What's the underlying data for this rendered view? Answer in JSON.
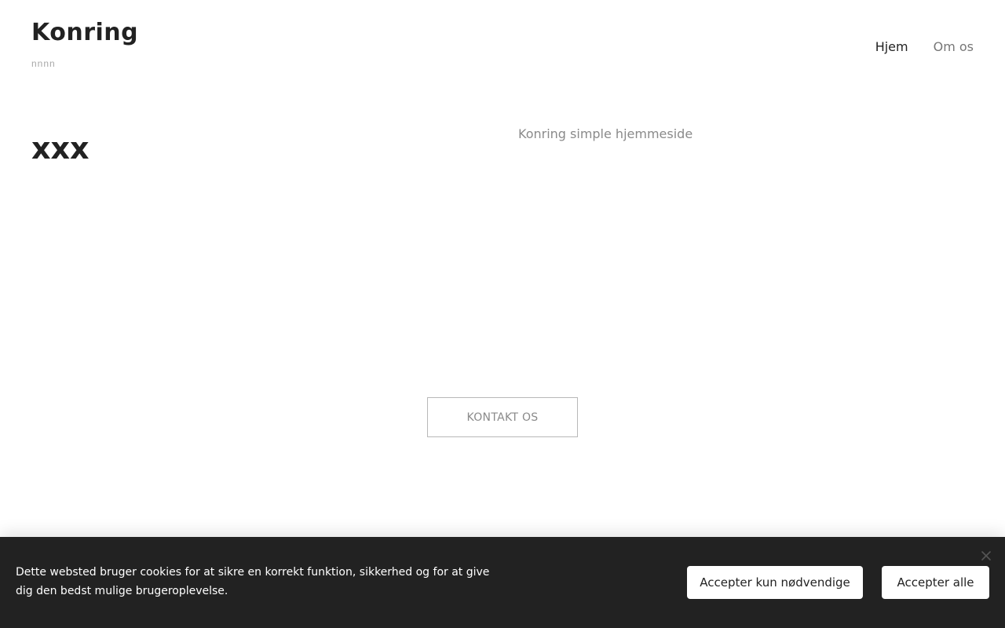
{
  "header": {
    "brand_title": "Konring",
    "brand_tagline": "nnnn",
    "nav": [
      {
        "label": "Hjem",
        "active": true
      },
      {
        "label": "Om os",
        "active": false
      }
    ]
  },
  "hero": {
    "heading": "xxx",
    "subtitle": "Konring simple hjemmeside",
    "cta_label": "KONTAKT OS"
  },
  "cookie_banner": {
    "text": "Dette websted bruger cookies for at sikre en korrekt funktion, sikkerhed og for at give dig den bedst mulige brugeroplevelse.",
    "accept_necessary_label": "Accepter kun nødvendige",
    "accept_all_label": "Accepter alle",
    "close_icon": "close-icon"
  },
  "colors": {
    "text_dark": "#222222",
    "text_muted": "#8a8a8a",
    "banner_bg": "#222222",
    "banner_text": "#ffffff"
  }
}
